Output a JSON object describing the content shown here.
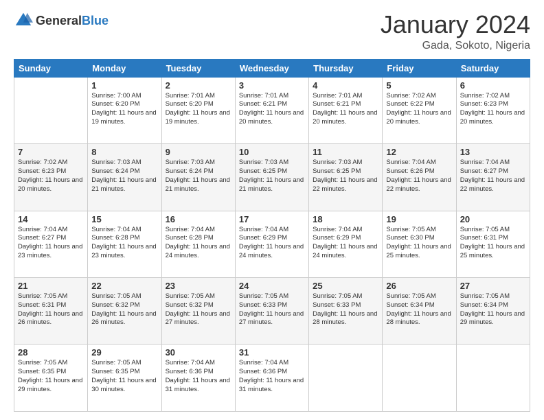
{
  "header": {
    "logo_general": "General",
    "logo_blue": "Blue",
    "month_title": "January 2024",
    "location": "Gada, Sokoto, Nigeria"
  },
  "days_of_week": [
    "Sunday",
    "Monday",
    "Tuesday",
    "Wednesday",
    "Thursday",
    "Friday",
    "Saturday"
  ],
  "weeks": [
    [
      {
        "day": "",
        "sunrise": "",
        "sunset": "",
        "daylight": ""
      },
      {
        "day": "1",
        "sunrise": "Sunrise: 7:00 AM",
        "sunset": "Sunset: 6:20 PM",
        "daylight": "Daylight: 11 hours and 19 minutes."
      },
      {
        "day": "2",
        "sunrise": "Sunrise: 7:01 AM",
        "sunset": "Sunset: 6:20 PM",
        "daylight": "Daylight: 11 hours and 19 minutes."
      },
      {
        "day": "3",
        "sunrise": "Sunrise: 7:01 AM",
        "sunset": "Sunset: 6:21 PM",
        "daylight": "Daylight: 11 hours and 20 minutes."
      },
      {
        "day": "4",
        "sunrise": "Sunrise: 7:01 AM",
        "sunset": "Sunset: 6:21 PM",
        "daylight": "Daylight: 11 hours and 20 minutes."
      },
      {
        "day": "5",
        "sunrise": "Sunrise: 7:02 AM",
        "sunset": "Sunset: 6:22 PM",
        "daylight": "Daylight: 11 hours and 20 minutes."
      },
      {
        "day": "6",
        "sunrise": "Sunrise: 7:02 AM",
        "sunset": "Sunset: 6:23 PM",
        "daylight": "Daylight: 11 hours and 20 minutes."
      }
    ],
    [
      {
        "day": "7",
        "sunrise": "Sunrise: 7:02 AM",
        "sunset": "Sunset: 6:23 PM",
        "daylight": "Daylight: 11 hours and 20 minutes."
      },
      {
        "day": "8",
        "sunrise": "Sunrise: 7:03 AM",
        "sunset": "Sunset: 6:24 PM",
        "daylight": "Daylight: 11 hours and 21 minutes."
      },
      {
        "day": "9",
        "sunrise": "Sunrise: 7:03 AM",
        "sunset": "Sunset: 6:24 PM",
        "daylight": "Daylight: 11 hours and 21 minutes."
      },
      {
        "day": "10",
        "sunrise": "Sunrise: 7:03 AM",
        "sunset": "Sunset: 6:25 PM",
        "daylight": "Daylight: 11 hours and 21 minutes."
      },
      {
        "day": "11",
        "sunrise": "Sunrise: 7:03 AM",
        "sunset": "Sunset: 6:25 PM",
        "daylight": "Daylight: 11 hours and 22 minutes."
      },
      {
        "day": "12",
        "sunrise": "Sunrise: 7:04 AM",
        "sunset": "Sunset: 6:26 PM",
        "daylight": "Daylight: 11 hours and 22 minutes."
      },
      {
        "day": "13",
        "sunrise": "Sunrise: 7:04 AM",
        "sunset": "Sunset: 6:27 PM",
        "daylight": "Daylight: 11 hours and 22 minutes."
      }
    ],
    [
      {
        "day": "14",
        "sunrise": "Sunrise: 7:04 AM",
        "sunset": "Sunset: 6:27 PM",
        "daylight": "Daylight: 11 hours and 23 minutes."
      },
      {
        "day": "15",
        "sunrise": "Sunrise: 7:04 AM",
        "sunset": "Sunset: 6:28 PM",
        "daylight": "Daylight: 11 hours and 23 minutes."
      },
      {
        "day": "16",
        "sunrise": "Sunrise: 7:04 AM",
        "sunset": "Sunset: 6:28 PM",
        "daylight": "Daylight: 11 hours and 24 minutes."
      },
      {
        "day": "17",
        "sunrise": "Sunrise: 7:04 AM",
        "sunset": "Sunset: 6:29 PM",
        "daylight": "Daylight: 11 hours and 24 minutes."
      },
      {
        "day": "18",
        "sunrise": "Sunrise: 7:04 AM",
        "sunset": "Sunset: 6:29 PM",
        "daylight": "Daylight: 11 hours and 24 minutes."
      },
      {
        "day": "19",
        "sunrise": "Sunrise: 7:05 AM",
        "sunset": "Sunset: 6:30 PM",
        "daylight": "Daylight: 11 hours and 25 minutes."
      },
      {
        "day": "20",
        "sunrise": "Sunrise: 7:05 AM",
        "sunset": "Sunset: 6:31 PM",
        "daylight": "Daylight: 11 hours and 25 minutes."
      }
    ],
    [
      {
        "day": "21",
        "sunrise": "Sunrise: 7:05 AM",
        "sunset": "Sunset: 6:31 PM",
        "daylight": "Daylight: 11 hours and 26 minutes."
      },
      {
        "day": "22",
        "sunrise": "Sunrise: 7:05 AM",
        "sunset": "Sunset: 6:32 PM",
        "daylight": "Daylight: 11 hours and 26 minutes."
      },
      {
        "day": "23",
        "sunrise": "Sunrise: 7:05 AM",
        "sunset": "Sunset: 6:32 PM",
        "daylight": "Daylight: 11 hours and 27 minutes."
      },
      {
        "day": "24",
        "sunrise": "Sunrise: 7:05 AM",
        "sunset": "Sunset: 6:33 PM",
        "daylight": "Daylight: 11 hours and 27 minutes."
      },
      {
        "day": "25",
        "sunrise": "Sunrise: 7:05 AM",
        "sunset": "Sunset: 6:33 PM",
        "daylight": "Daylight: 11 hours and 28 minutes."
      },
      {
        "day": "26",
        "sunrise": "Sunrise: 7:05 AM",
        "sunset": "Sunset: 6:34 PM",
        "daylight": "Daylight: 11 hours and 28 minutes."
      },
      {
        "day": "27",
        "sunrise": "Sunrise: 7:05 AM",
        "sunset": "Sunset: 6:34 PM",
        "daylight": "Daylight: 11 hours and 29 minutes."
      }
    ],
    [
      {
        "day": "28",
        "sunrise": "Sunrise: 7:05 AM",
        "sunset": "Sunset: 6:35 PM",
        "daylight": "Daylight: 11 hours and 29 minutes."
      },
      {
        "day": "29",
        "sunrise": "Sunrise: 7:05 AM",
        "sunset": "Sunset: 6:35 PM",
        "daylight": "Daylight: 11 hours and 30 minutes."
      },
      {
        "day": "30",
        "sunrise": "Sunrise: 7:04 AM",
        "sunset": "Sunset: 6:36 PM",
        "daylight": "Daylight: 11 hours and 31 minutes."
      },
      {
        "day": "31",
        "sunrise": "Sunrise: 7:04 AM",
        "sunset": "Sunset: 6:36 PM",
        "daylight": "Daylight: 11 hours and 31 minutes."
      },
      {
        "day": "",
        "sunrise": "",
        "sunset": "",
        "daylight": ""
      },
      {
        "day": "",
        "sunrise": "",
        "sunset": "",
        "daylight": ""
      },
      {
        "day": "",
        "sunrise": "",
        "sunset": "",
        "daylight": ""
      }
    ]
  ]
}
